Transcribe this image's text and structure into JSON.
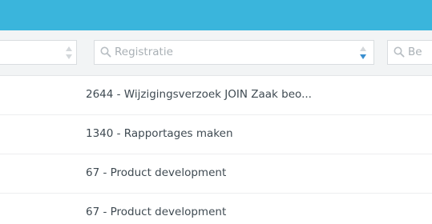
{
  "header": {
    "accent_color": "#3ab5dc"
  },
  "filters": {
    "registratie_placeholder": "Registratie",
    "next_placeholder": "Be"
  },
  "rows": [
    {
      "registratie": "2644 - Wijzigingsverzoek JOIN Zaak beo..."
    },
    {
      "registratie": "1340 - Rapportages maken"
    },
    {
      "registratie": "67 - Product development"
    },
    {
      "registratie": "67 - Product development"
    }
  ]
}
